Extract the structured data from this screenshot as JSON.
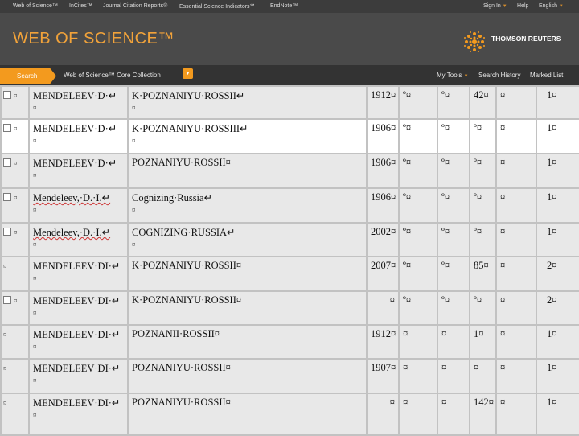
{
  "topbar": {
    "links": [
      "Web of Science™",
      "InCites™",
      "Journal Citation Reports®",
      "Essential Science Indicators℠",
      "EndNote™"
    ],
    "sign_in": "Sign In",
    "help": "Help",
    "language": "English"
  },
  "header": {
    "brand": "WEB OF SCIENCE™",
    "publisher": "THOMSON REUTERS"
  },
  "nav": {
    "search_tab": "Search",
    "collection": "Web of Science™ Core Collection",
    "my_tools": "My Tools",
    "search_history": "Search History",
    "marked_list": "Marked List"
  },
  "rows": [
    {
      "author": "MENDELEEV·D·↵",
      "author_sub": "¤",
      "title": "K·POZNANIYU·ROSSII↵",
      "title_sub": "¤",
      "year": "1912¤",
      "c1": "º¤",
      "c2": "º¤",
      "c3": "42¤",
      "c4": "¤",
      "c5": "1¤"
    },
    {
      "author": "MENDELEEV·D·↵",
      "author_sub": "¤",
      "title": "K·POZNANIYU·ROSSIII↵",
      "title_sub": "¤",
      "year": "1906¤",
      "c1": "º¤",
      "c2": "º¤",
      "c3": "º¤",
      "c4": "¤",
      "c5": "1¤"
    },
    {
      "author": "MENDELEEV·D·↵",
      "author_sub": "¤",
      "title": "POZNANIYU·ROSSII¤",
      "title_sub": "",
      "year": "1906¤",
      "c1": "º¤",
      "c2": "º¤",
      "c3": "º¤",
      "c4": "¤",
      "c5": "1¤"
    },
    {
      "author": "Mendeleev,·D.·I.↵",
      "author_sub": "¤",
      "title": "Cognizing·Russia↵",
      "title_sub": "¤",
      "year": "1906¤",
      "c1": "º¤",
      "c2": "º¤",
      "c3": "º¤",
      "c4": "¤",
      "c5": "1¤"
    },
    {
      "author": "Mendeleev,·D.·I.↵",
      "author_sub": "¤",
      "title": "COGNIZING·RUSSIA↵",
      "title_sub": "¤",
      "year": "2002¤",
      "c1": "º¤",
      "c2": "º¤",
      "c3": "º¤",
      "c4": "¤",
      "c5": "1¤"
    },
    {
      "author": "MENDELEEV·DI·↵",
      "author_sub": "¤",
      "title": "K·POZNANIYU·ROSSII¤",
      "title_sub": "",
      "year": "2007¤",
      "c1": "º¤",
      "c2": "º¤",
      "c3": "85¤",
      "c4": "¤",
      "c5": "2¤"
    },
    {
      "author": "MENDELEEV·DI·↵",
      "author_sub": "¤",
      "title": "K·POZNANIYU·ROSSII¤",
      "title_sub": "",
      "year": "¤",
      "c1": "º¤",
      "c2": "º¤",
      "c3": "º¤",
      "c4": "¤",
      "c5": "2¤"
    },
    {
      "author": "MENDELEEV·DI·↵",
      "author_sub": "¤",
      "title": "POZNANII·ROSSII¤",
      "title_sub": "",
      "year": "1912¤",
      "c1": "¤",
      "c2": "¤",
      "c3": "1¤",
      "c4": "¤",
      "c5": "1¤"
    },
    {
      "author": "MENDELEEV·DI·↵",
      "author_sub": "¤",
      "title": "POZNANIYU·ROSSII¤",
      "title_sub": "",
      "year": "1907¤",
      "c1": "¤",
      "c2": "¤",
      "c3": "¤",
      "c4": "¤",
      "c5": "1¤"
    },
    {
      "author": "MENDELEEV·DI·↵",
      "author_sub": "¤",
      "title": "POZNANIYU·ROSSII¤",
      "title_sub": "",
      "year": "¤",
      "c1": "¤",
      "c2": "¤",
      "c3": "142¤",
      "c4": "¤",
      "c5": "1¤"
    }
  ],
  "checkbox_rows": [
    true,
    true,
    true,
    true,
    true,
    false,
    true,
    false,
    false,
    false
  ],
  "leading_marks": [
    "¤",
    "¤",
    "¤",
    "¤",
    "¤",
    "¤",
    "¤",
    "¤",
    "¤",
    "¤"
  ],
  "colors": {
    "accent": "#f39a1e",
    "header_bg": "#4a4a4a",
    "topbar_bg": "#3c3c3c",
    "nav_bg": "#333333"
  },
  "icons": [
    "thomson-reuters-logo-icon",
    "caret-down-icon",
    "dropdown-icon",
    "checkbox-icon"
  ]
}
